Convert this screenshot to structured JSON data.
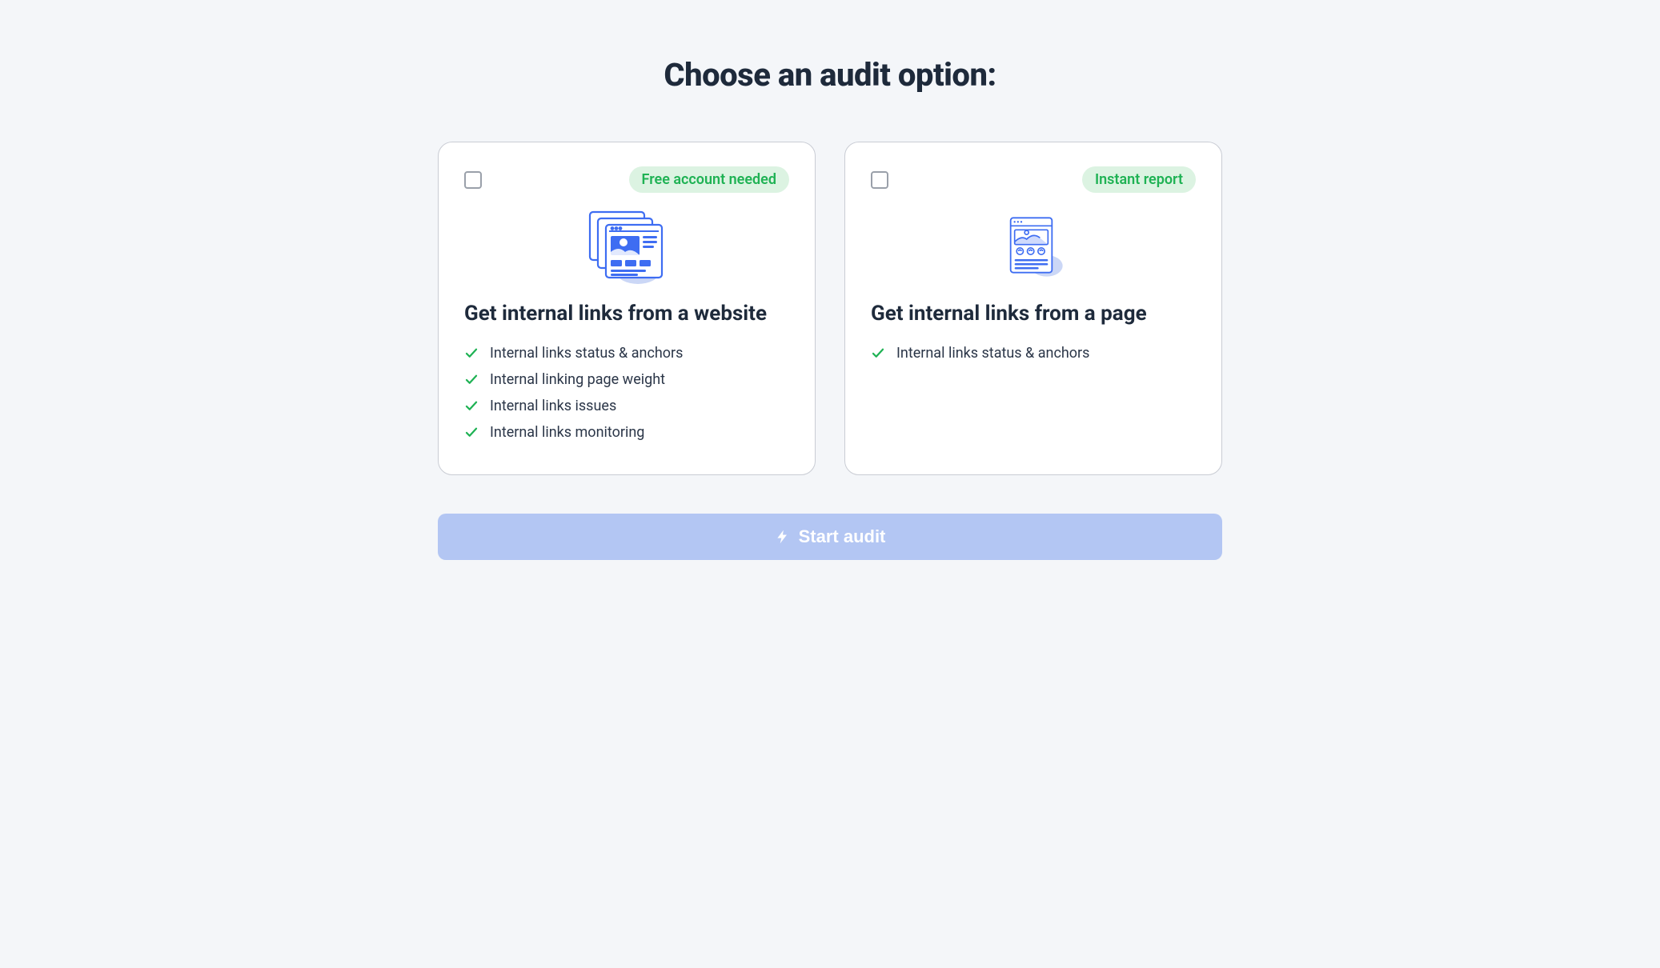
{
  "title": "Choose an audit option:",
  "cards": [
    {
      "badge": "Free account needed",
      "title": "Get internal links from a website",
      "features": [
        "Internal links status & anchors",
        "Internal linking page weight",
        "Internal links issues",
        "Internal links monitoring"
      ]
    },
    {
      "badge": "Instant report",
      "title": "Get internal links from a page",
      "features": [
        "Internal links status & anchors"
      ]
    }
  ],
  "cta": {
    "label": "Start audit"
  },
  "colors": {
    "accent_blue": "#3e6df2",
    "soft_blue": "#b3c6f3",
    "green": "#1fb254",
    "badge_bg": "#dcf3e2",
    "text": "#1e2a3b",
    "border": "#c9ccd4",
    "bg": "#f4f6f9"
  }
}
